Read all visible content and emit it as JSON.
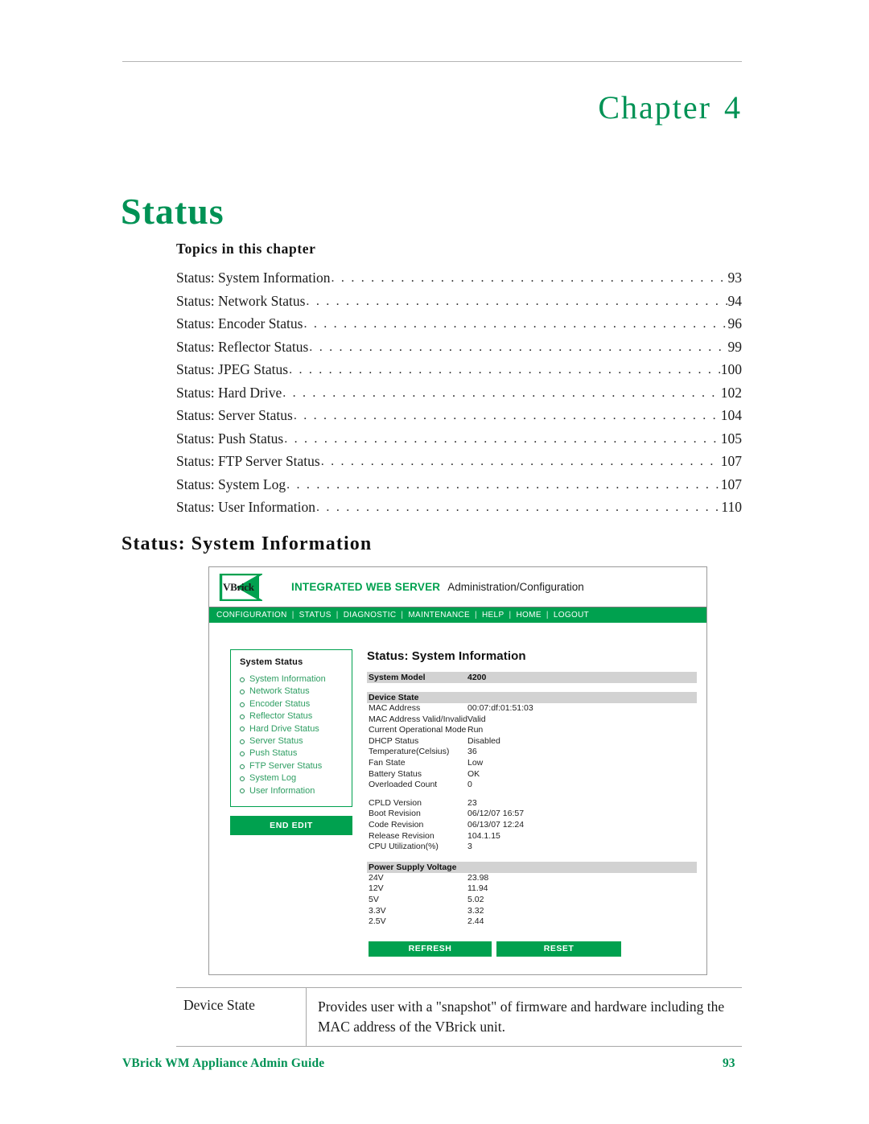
{
  "page": {
    "chapter_label": "Chapter",
    "chapter_number": "4",
    "chapter_title": "Status",
    "topics_heading": "Topics in this chapter",
    "section_heading": "Status: System Information",
    "accent_green": "#009255",
    "ui_green": "#00a14f"
  },
  "toc": {
    "entries": [
      {
        "label": "Status: System Information",
        "page": "93"
      },
      {
        "label": "Status: Network Status",
        "page": "94"
      },
      {
        "label": "Status: Encoder Status",
        "page": "96"
      },
      {
        "label": "Status: Reflector Status",
        "page": "99"
      },
      {
        "label": "Status: JPEG Status",
        "page": "100"
      },
      {
        "label": "Status: Hard Drive",
        "page": "102"
      },
      {
        "label": "Status: Server Status",
        "page": "104"
      },
      {
        "label": "Status: Push Status",
        "page": "105"
      },
      {
        "label": "Status: FTP Server Status",
        "page": "107"
      },
      {
        "label": "Status: System Log",
        "page": "107"
      },
      {
        "label": "Status: User Information",
        "page": "110"
      }
    ],
    "dots": ". . . . . . . . . . . . . . . . . . . . . . . . . . . . . . . . . . . . . . . . . . . . . . . . . . . . . . . . . . . . . . . . . . . . . . . . . . . . . . . . . . . . . . . . . . . . . . . . . . . . . . . . . . . . . . . ."
  },
  "screenshot": {
    "brand": {
      "logo_text": "VBrick",
      "product": "INTEGRATED WEB SERVER",
      "subtitle": "Administration/Configuration"
    },
    "nav": {
      "separator": "|",
      "items": [
        "CONFIGURATION",
        "STATUS",
        "DIAGNOSTIC",
        "MAINTENANCE",
        "HELP",
        "HOME",
        "LOGOUT"
      ]
    },
    "sidebar": {
      "title": "System Status",
      "items": [
        "System Information",
        "Network Status",
        "Encoder Status",
        "Reflector Status",
        "Hard Drive Status",
        "Server Status",
        "Push Status",
        "FTP Server Status",
        "System Log",
        "User Information"
      ],
      "end_edit_label": "END EDIT"
    },
    "panel": {
      "title": "Status: System Information",
      "system_model": {
        "label": "System Model",
        "value": "4200"
      },
      "device_state": {
        "header": "Device State",
        "group_a": [
          {
            "key": "MAC Address",
            "value": "00:07:df:01:51:03"
          },
          {
            "key": "MAC Address Valid/Invalid",
            "value": "Valid"
          },
          {
            "key": "Current Operational Mode",
            "value": "Run"
          },
          {
            "key": "DHCP Status",
            "value": "Disabled"
          },
          {
            "key": "Temperature(Celsius)",
            "value": "36"
          },
          {
            "key": "Fan State",
            "value": "Low"
          },
          {
            "key": "Battery Status",
            "value": "OK"
          },
          {
            "key": "Overloaded Count",
            "value": "0"
          }
        ],
        "group_b": [
          {
            "key": "CPLD Version",
            "value": "23"
          },
          {
            "key": "Boot Revision",
            "value": "06/12/07 16:57"
          },
          {
            "key": "Code Revision",
            "value": "06/13/07 12:24"
          },
          {
            "key": "Release Revision",
            "value": "104.1.15"
          },
          {
            "key": "CPU Utilization(%)",
            "value": "3"
          }
        ]
      },
      "power_supply": {
        "header": "Power Supply Voltage",
        "rows": [
          {
            "key": "24V",
            "value": "23.98"
          },
          {
            "key": "12V",
            "value": "11.94"
          },
          {
            "key": "5V",
            "value": "5.02"
          },
          {
            "key": "3.3V",
            "value": "3.32"
          },
          {
            "key": "2.5V",
            "value": "2.44"
          }
        ]
      },
      "buttons": {
        "refresh": "REFRESH",
        "reset": "RESET"
      }
    }
  },
  "description_table": {
    "term": "Device State",
    "definition": "Provides user with a \"snapshot\" of firmware and hardware including the MAC address of the VBrick unit."
  },
  "footer": {
    "left": "VBrick WM Appliance Admin Guide",
    "page_number": "93"
  }
}
